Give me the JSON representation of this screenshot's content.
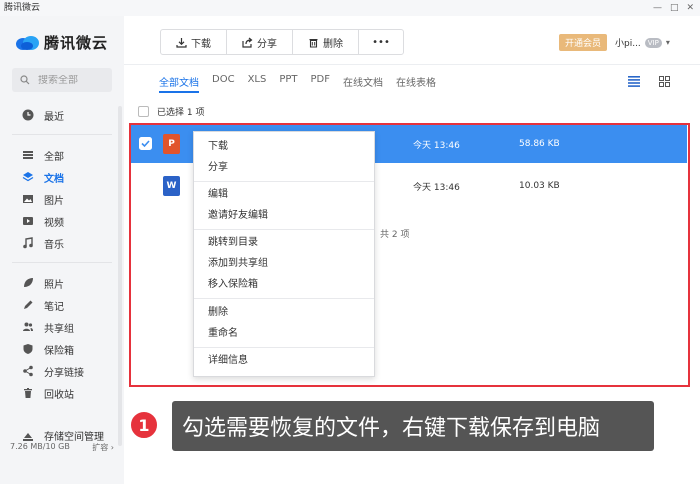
{
  "titlebar": {
    "title": "腾讯微云",
    "controls": [
      "—",
      "□",
      "✕"
    ]
  },
  "sidebar": {
    "logo_text": "腾讯微云",
    "search_placeholder": "搜索全部",
    "recent": "最近",
    "group1": [
      "全部",
      "文档",
      "图片",
      "视频",
      "音乐"
    ],
    "group2": [
      "照片",
      "笔记",
      "共享组",
      "保险箱",
      "分享链接",
      "回收站"
    ],
    "storage_label": "存储空间管理",
    "storage_used": "7.26 MB/10 GB",
    "expand": "扩容 ›"
  },
  "toolbar": {
    "download": "下载",
    "share": "分享",
    "delete": "删除",
    "more": "•••"
  },
  "header": {
    "vip_button": "开通会员",
    "username": "小pi...",
    "vip_badge": "VIP",
    "caret": "▾"
  },
  "tabs": [
    "全部文档",
    "DOC",
    "XLS",
    "PPT",
    "PDF",
    "在线文档",
    "在线表格"
  ],
  "selection": {
    "label": "已选择 1 项"
  },
  "files": [
    {
      "type": "ppt",
      "badge": "P",
      "time": "今天 13:46",
      "size": "58.86 KB"
    },
    {
      "type": "word",
      "badge": "W",
      "time": "今天 13:46",
      "size": "10.03 KB"
    }
  ],
  "footer_count": "共 2 项",
  "context_menu": {
    "group1": [
      "下载",
      "分享"
    ],
    "group2": [
      "编辑",
      "邀请好友编辑"
    ],
    "group3": [
      "跳转到目录",
      "添加到共享组",
      "移入保险箱"
    ],
    "group4": [
      "删除",
      "重命名"
    ],
    "group5": [
      "详细信息"
    ]
  },
  "annotation": {
    "step": "1",
    "text": "勾选需要恢复的文件，右键下载保存到电脑"
  },
  "colors": {
    "accent": "#1a73e8",
    "selected_row": "#3b8ef0",
    "highlight": "#e6323c",
    "vip": "#e9b97a",
    "ppt": "#e1542c",
    "word": "#2b62c7"
  }
}
